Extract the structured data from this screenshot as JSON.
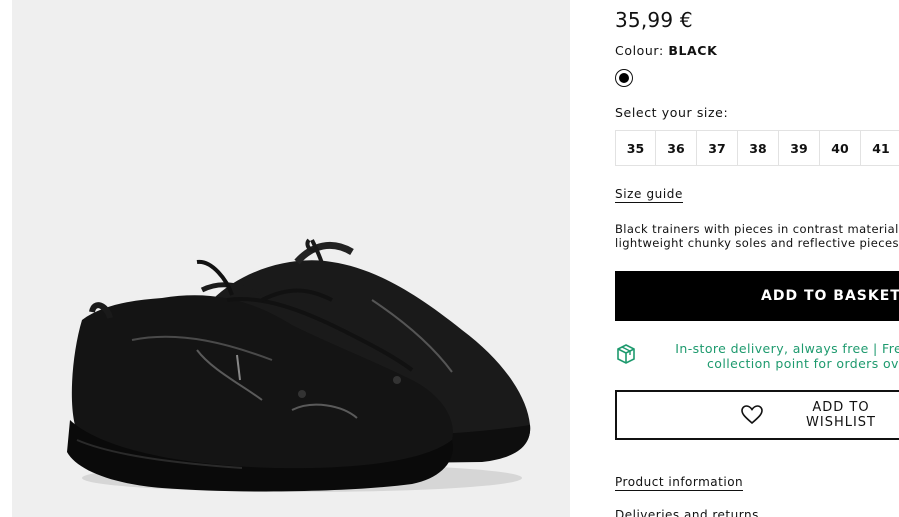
{
  "product": {
    "price": "35,99 €",
    "colour_label": "Colour:",
    "colour_value": "BLACK",
    "swatch_color": "#000000",
    "image_icon": "black-chunky-trainers-photo"
  },
  "sizes": {
    "label": "Select your size:",
    "options": [
      "35",
      "36",
      "37",
      "38",
      "39",
      "40",
      "41"
    ]
  },
  "size_guide": "Size guide",
  "description": {
    "line1": "Black trainers with pieces in contrast materials, m",
    "line2": "lightweight chunky soles and reflective pieces."
  },
  "actions": {
    "add_to_basket": "ADD TO BASKET",
    "add_to_wishlist": "ADD TO WISHLIST"
  },
  "delivery": {
    "icon": "package-icon",
    "line1": "In-store delivery, always free | Free deli",
    "line2": "collection point for orders ove",
    "color": "#1e9a6e"
  },
  "links": {
    "product_information": "Product information",
    "deliveries_returns": "Deliveries and returns"
  }
}
